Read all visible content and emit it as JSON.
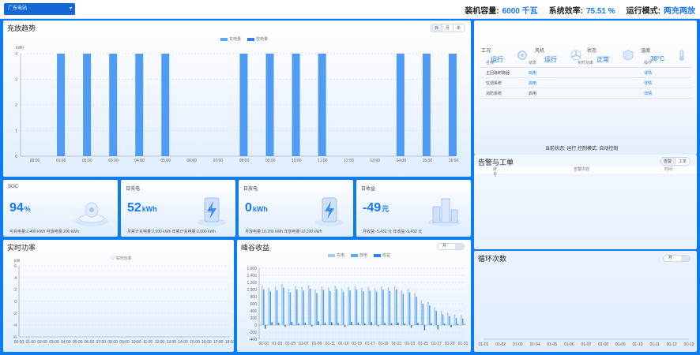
{
  "topbar": {
    "station": "广东电站",
    "kpis": [
      {
        "label": "装机容量:",
        "value": "6000 千瓦"
      },
      {
        "label": "系统效率:",
        "value": "75.51 %"
      },
      {
        "label": "运行模式:",
        "value": "两充两放"
      }
    ]
  },
  "trend": {
    "title": "充放趋势",
    "tabs": [
      "日",
      "月",
      "年"
    ],
    "legend": [
      "充电量",
      "放电量"
    ]
  },
  "kpi_cards": [
    {
      "label": "SOC",
      "value": "94",
      "unit": "%",
      "sub": "可充电量:2,400 kWh    可放电量:200 kWh"
    },
    {
      "label": "日充电",
      "value": "52",
      "unit": "kWh",
      "sub": "月累计充电量:2,000 kWh    年累计充电量:2,000 kWh"
    },
    {
      "label": "日放电",
      "value": "0",
      "unit": "kWh",
      "sub": "月放电量:10,200 kWh    年放电量:10,200 kWh"
    },
    {
      "label": "日收益",
      "value": "-49",
      "unit": "元",
      "sub": "月收益:-5,432 元    年收益:-5,432 元"
    }
  ],
  "realtime": {
    "title": "实时功率",
    "legend": "实时功率"
  },
  "peak_valley": {
    "title": "峰谷收益",
    "selector": "月",
    "legend": [
      "充电",
      "放电",
      "收益"
    ]
  },
  "status": {
    "items": [
      {
        "name": "工况",
        "value": "运行"
      },
      {
        "name": "风机",
        "value": "运行"
      },
      {
        "name": "状态",
        "value": "正常"
      },
      {
        "name": "温度",
        "value": "38°C"
      }
    ],
    "columns": [
      "名称",
      "状态",
      "实时功率",
      "操作"
    ],
    "rows": [
      {
        "name": "主回路断路器",
        "state": "启用",
        "action": "详情"
      },
      {
        "name": "空调系统",
        "state": "启用",
        "action": "详情"
      },
      {
        "name": "消防系统",
        "state": "启用",
        "action": "详情"
      }
    ],
    "control": "当前状态: 运行    控制模式: 自动控制"
  },
  "alarms": {
    "title": "告警与工单",
    "tabs": [
      "告警",
      "工单"
    ],
    "columns": [
      "序号",
      "告警内容",
      "时间"
    ]
  },
  "cycles": {
    "title": "循环次数",
    "selector": "月",
    "x_labels": [
      "01-01",
      "01-02",
      "01-03",
      "01-04",
      "01-05",
      "01-06",
      "01-07",
      "01-08",
      "01-09",
      "01-10",
      "01-11",
      "01-12",
      "01-13"
    ]
  },
  "chart_data": [
    {
      "type": "bar",
      "title": "充放趋势",
      "ylabel": "kWh",
      "ylim": [
        0,
        4
      ],
      "y_ticks": [
        0,
        1,
        2,
        3,
        4
      ],
      "categories": [
        "00:00",
        "01:00",
        "02:00",
        "03:00",
        "04:00",
        "05:00",
        "06:00",
        "07:00",
        "08:00",
        "09:00",
        "10:00",
        "11:00",
        "12:00",
        "13:00",
        "14:00",
        "15:00",
        "16:00",
        "17:00",
        "18:00",
        "19:00",
        "20:00",
        "21:00",
        "22:00",
        "23:00"
      ],
      "x_tick_labels": [
        "00:00",
        "01:00",
        "02:00",
        "03:00",
        "04:00",
        "05:00",
        "06:00",
        "07:00",
        "08:00",
        "09:00",
        "10:00",
        "11:00",
        "12:00",
        "13:00",
        "14:00",
        "15:00",
        "16:00"
      ],
      "series": [
        {
          "name": "充电量",
          "values": [
            0,
            4,
            4,
            4,
            4,
            4,
            0,
            0,
            4,
            4,
            4,
            4,
            0,
            0,
            4,
            4,
            4,
            0,
            0,
            0,
            0,
            0,
            0,
            0
          ]
        },
        {
          "name": "放电量",
          "values": [
            0,
            0,
            0,
            0,
            0,
            0,
            0,
            0,
            0,
            0,
            0,
            0,
            0,
            0,
            0,
            0,
            0,
            0,
            0,
            0,
            0,
            0,
            0,
            0
          ]
        }
      ]
    },
    {
      "type": "line",
      "title": "实时功率",
      "ylabel": "kW",
      "ylim": [
        -6,
        6
      ],
      "y_ticks": [
        6,
        4,
        2,
        0,
        -2,
        -4,
        -6
      ],
      "x": [
        "00:00",
        "01:00",
        "02:00",
        "03:00",
        "04:00",
        "05:00",
        "06:00",
        "07:00",
        "08:00",
        "09:00",
        "10:00",
        "11:00",
        "12:00",
        "13:00",
        "14:00",
        "15:00",
        "16:00",
        "17:00",
        "18:00"
      ],
      "series": [
        {
          "name": "实时功率",
          "values": []
        }
      ]
    },
    {
      "type": "bar",
      "title": "峰谷收益",
      "ylim": [
        -400,
        1600
      ],
      "y_ticks": [
        1600,
        1400,
        1200,
        1000,
        800,
        600,
        400,
        200,
        0,
        -200,
        -400
      ],
      "x_tick_labels": [
        "01-01",
        "01-03",
        "01-05",
        "01-07",
        "01-09",
        "01-11",
        "01-13",
        "01-15",
        "01-17",
        "01-19",
        "01-21",
        "01-23",
        "01-25",
        "01-27",
        "01-29",
        "01-31"
      ],
      "series": [
        {
          "name": "充电",
          "values": [
            1100,
            1050,
            1080,
            1150,
            1020,
            1100,
            1070,
            1120,
            1000,
            1090,
            1060,
            1110,
            1030,
            1080,
            1100,
            1050,
            1070,
            1040,
            1090,
            1060,
            1100,
            980,
            1020,
            900,
            700,
            650,
            500,
            400,
            350,
            300,
            280
          ]
        },
        {
          "name": "放电",
          "values": [
            1000,
            950,
            980,
            1050,
            920,
            1000,
            970,
            1020,
            900,
            990,
            960,
            1010,
            930,
            980,
            1000,
            950,
            970,
            940,
            990,
            960,
            1000,
            880,
            920,
            800,
            600,
            550,
            400,
            300,
            250,
            200,
            180
          ]
        },
        {
          "name": "收益",
          "values": [
            -100,
            80,
            60,
            -50,
            90,
            40,
            70,
            -40,
            100,
            60,
            80,
            50,
            -60,
            90,
            70,
            40,
            80,
            -30,
            60,
            50,
            70,
            40,
            -80,
            60,
            -150,
            50,
            -120,
            40,
            -60,
            30,
            20
          ]
        }
      ]
    },
    {
      "type": "line",
      "title": "循环次数",
      "categories": [
        "01-01",
        "01-02",
        "01-03",
        "01-04",
        "01-05",
        "01-06",
        "01-07",
        "01-08",
        "01-09",
        "01-10",
        "01-11",
        "01-12",
        "01-13"
      ],
      "series": [
        {
          "name": "循环次数",
          "values": []
        }
      ]
    }
  ]
}
